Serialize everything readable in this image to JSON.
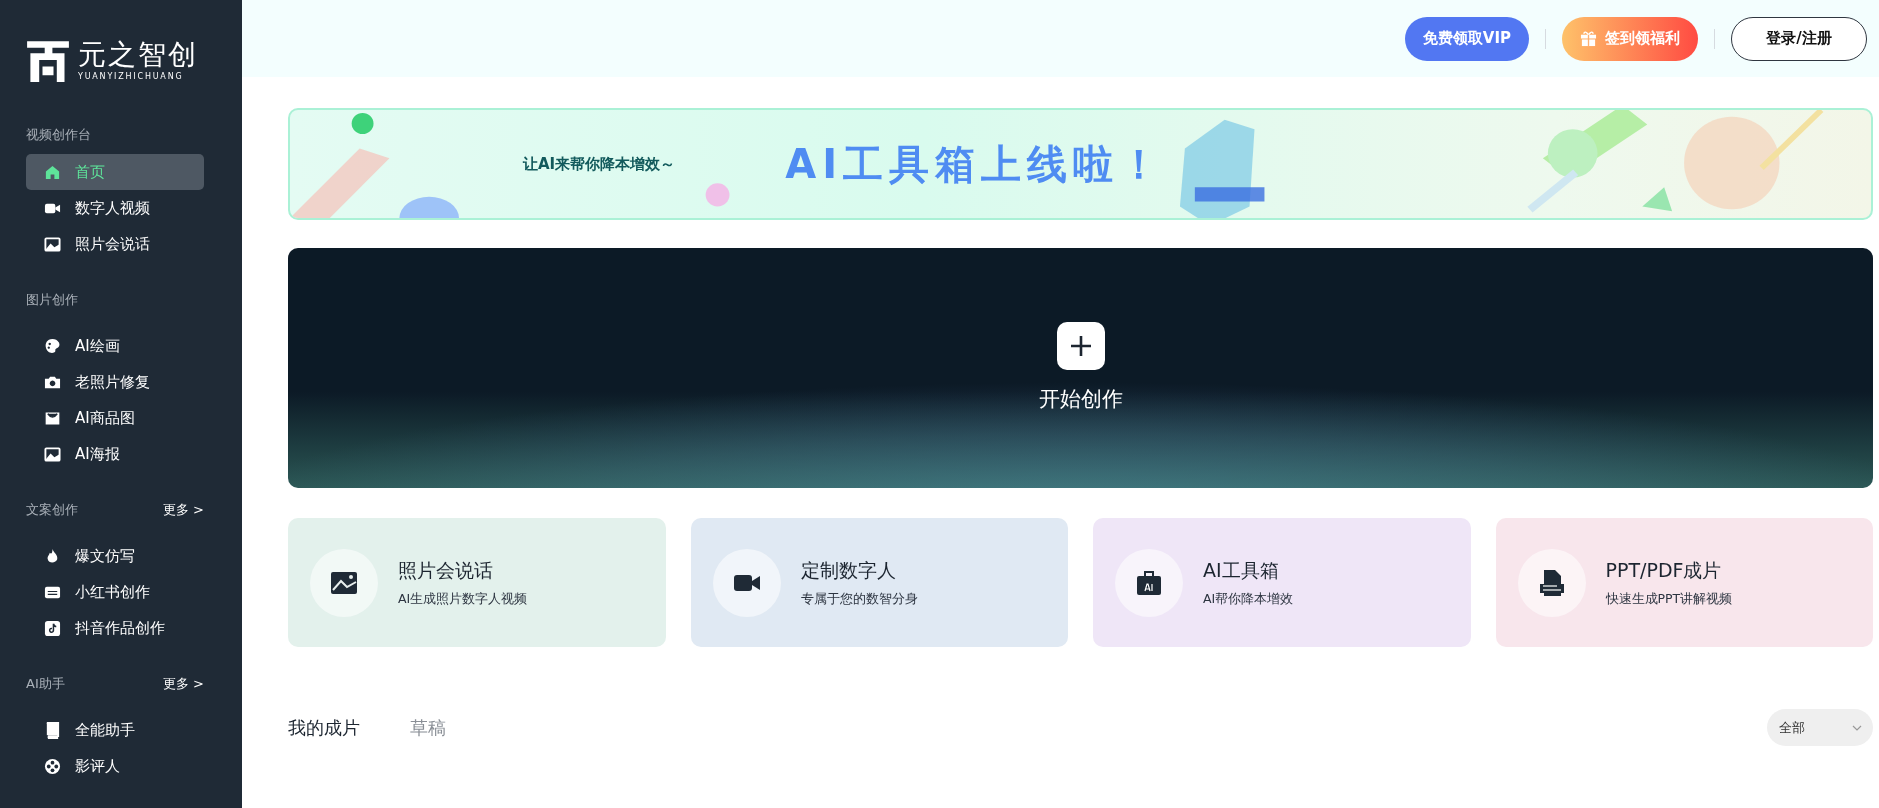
{
  "logo": {
    "name": "元之智创",
    "subtitle": "YUANYIZHICHUANG"
  },
  "sidebar": {
    "sections": [
      {
        "title": "视频创作台",
        "items": [
          {
            "label": "首页",
            "kind": "home",
            "selected": true
          },
          {
            "label": "数字人视频",
            "kind": "video",
            "selected": false
          },
          {
            "label": "照片会说话",
            "kind": "image",
            "selected": false
          }
        ]
      },
      {
        "title": "图片创作",
        "items": [
          {
            "label": "AI绘画",
            "kind": "palette",
            "selected": false
          },
          {
            "label": "老照片修复",
            "kind": "camera",
            "selected": false
          },
          {
            "label": "AI商品图",
            "kind": "bag",
            "selected": false
          },
          {
            "label": "AI海报",
            "kind": "image",
            "selected": false
          }
        ]
      },
      {
        "title": "文案创作",
        "more": "更多 >",
        "items": [
          {
            "label": "爆文仿写",
            "kind": "fire",
            "selected": false
          },
          {
            "label": "小红书创作",
            "kind": "badge",
            "selected": false
          },
          {
            "label": "抖音作品创作",
            "kind": "note",
            "selected": false
          }
        ]
      },
      {
        "title": "AI助手",
        "more": "更多 >",
        "items": [
          {
            "label": "全能助手",
            "kind": "book",
            "selected": false
          },
          {
            "label": "影评人",
            "kind": "reel",
            "selected": false
          }
        ]
      }
    ]
  },
  "top_buttons": [
    {
      "label": "免费领取VIP",
      "kind": "vip"
    },
    {
      "label": "签到领福利",
      "kind": "gift"
    },
    {
      "label": "登录/注册",
      "kind": "outline"
    }
  ],
  "banner": {
    "tagline": "让AI来帮你降本增效～",
    "headline": "AI工具箱上线啦！"
  },
  "hero": {
    "label": "开始创作"
  },
  "cards": [
    {
      "title": "照片会说话",
      "subtitle": "AI生成照片数字人视频",
      "kind": "image",
      "color": "#e3f1ec"
    },
    {
      "title": "定制数字人",
      "subtitle": "专属于您的数智分身",
      "kind": "video",
      "color": "#e0e9f3"
    },
    {
      "title": "AI工具箱",
      "subtitle": "AI帮你降本增效",
      "kind": "toolbox",
      "color": "#efe6f7"
    },
    {
      "title": "PPT/PDF成片",
      "subtitle": "快速生成PPT讲解视频",
      "kind": "pdf",
      "color": "#f8e6ec"
    }
  ],
  "tabs": [
    {
      "label": "我的成片",
      "selected": true
    },
    {
      "label": "草稿",
      "selected": false
    }
  ],
  "filter": {
    "value": "全部"
  }
}
